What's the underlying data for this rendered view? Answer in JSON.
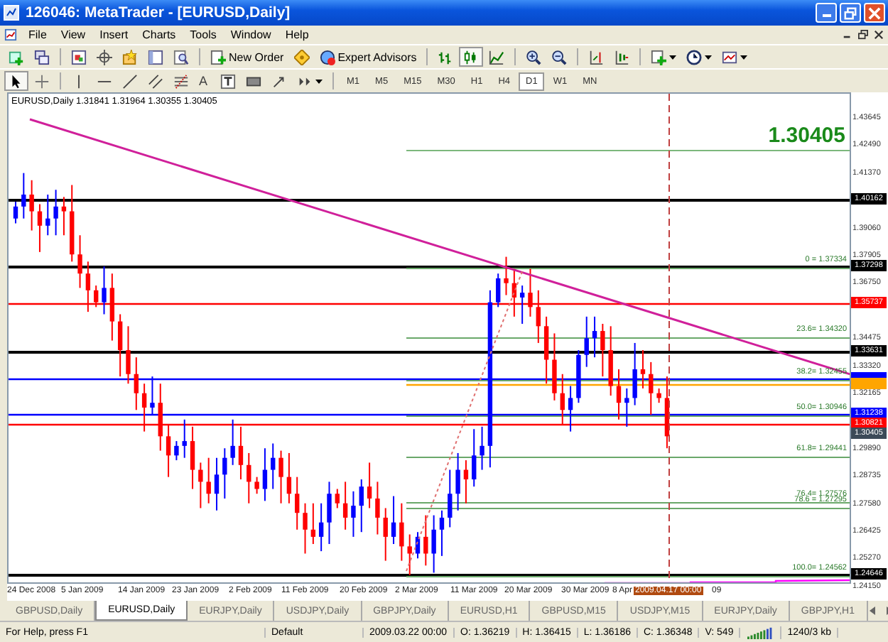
{
  "window": {
    "title": "126046: MetaTrader - [EURUSD,Daily]"
  },
  "menu": [
    "File",
    "View",
    "Insert",
    "Charts",
    "Tools",
    "Window",
    "Help"
  ],
  "toolbar": {
    "new_order": "New Order",
    "expert_advisors": "Expert Advisors",
    "text_tool": "A"
  },
  "timeframes": [
    {
      "label": "M1",
      "selected": false
    },
    {
      "label": "M5",
      "selected": false
    },
    {
      "label": "M15",
      "selected": false
    },
    {
      "label": "M30",
      "selected": false
    },
    {
      "label": "H1",
      "selected": false
    },
    {
      "label": "H4",
      "selected": false
    },
    {
      "label": "D1",
      "selected": true
    },
    {
      "label": "W1",
      "selected": false
    },
    {
      "label": "MN",
      "selected": false
    }
  ],
  "chart": {
    "info": "EURUSD,Daily  1.31841 1.31964 1.30355 1.30405",
    "price_label": "1.30405",
    "price_ticks": [
      "1.43645",
      "1.42490",
      "1.41370",
      "1.39060",
      "1.37905",
      "1.36750",
      "1.34475",
      "1.33320",
      "1.32165",
      "1.29890",
      "1.28735",
      "1.27580",
      "1.26425",
      "1.25270",
      "1.24150"
    ],
    "levels": [
      {
        "color": "#000000",
        "tag": "1.40162"
      },
      {
        "color": "#000000",
        "tag": "1.37298"
      },
      {
        "color": "#ff0000",
        "tag": "1.35737"
      },
      {
        "color": "#000000",
        "tag": "1.33631"
      },
      {
        "color": "#0000ff"
      },
      {
        "color": "#ffa500"
      },
      {
        "color": "#0000ff",
        "tag": "1.31238"
      },
      {
        "color": "#ff0000",
        "tag": "1.30821"
      },
      {
        "color": "#000000",
        "tag": "1.24646"
      }
    ],
    "bid_tag": "1.30405",
    "fibo_levels": [
      "0 = 1.37334",
      "23.6= 1.34320",
      "38.2= 1.32455",
      "50.0= 1.30946",
      "61.8= 1.29441",
      "76.4= 1.27576",
      "78.6 = 1.27295",
      "100.0= 1.24562"
    ],
    "dates": [
      {
        "kind": "date",
        "label": "24 Dec 2008"
      },
      {
        "kind": "date",
        "label": "5 Jan 2009"
      },
      {
        "kind": "date",
        "label": "14 Jan 2009"
      },
      {
        "kind": "date",
        "label": "23 Jan 2009"
      },
      {
        "kind": "date",
        "label": "2 Feb 2009"
      },
      {
        "kind": "date",
        "label": "11 Feb 2009"
      },
      {
        "kind": "date",
        "label": "20 Feb 2009"
      },
      {
        "kind": "date",
        "label": "2 Mar 2009"
      },
      {
        "kind": "date",
        "label": "11 Mar 2009"
      },
      {
        "kind": "date",
        "label": "20 Mar 2009"
      },
      {
        "kind": "date",
        "label": "30 Mar 2009"
      },
      {
        "kind": "date",
        "label": "8 Apr"
      },
      {
        "kind": "cursor",
        "label": "2009.04.17 00:00"
      },
      {
        "kind": "date",
        "label": "09"
      }
    ]
  },
  "tabs": [
    {
      "label": "GBPUSD,Daily",
      "selected": false
    },
    {
      "label": "EURUSD,Daily",
      "selected": true
    },
    {
      "label": "EURJPY,Daily",
      "selected": false
    },
    {
      "label": "USDJPY,Daily",
      "selected": false
    },
    {
      "label": "GBPJPY,Daily",
      "selected": false
    },
    {
      "label": "EURUSD,H1",
      "selected": false
    },
    {
      "label": "GBPUSD,M15",
      "selected": false
    },
    {
      "label": "USDJPY,M15",
      "selected": false
    },
    {
      "label": "EURJPY,Daily",
      "selected": false
    },
    {
      "label": "GBPJPY,H1",
      "selected": false
    }
  ],
  "status_bar": [
    "For Help, press F1",
    "Default",
    "2009.03.22 00:00",
    "O: 1.36219",
    "H: 1.36415",
    "L: 1.36186",
    "C: 1.36348",
    "V: 549",
    "1240/3 kb"
  ]
}
